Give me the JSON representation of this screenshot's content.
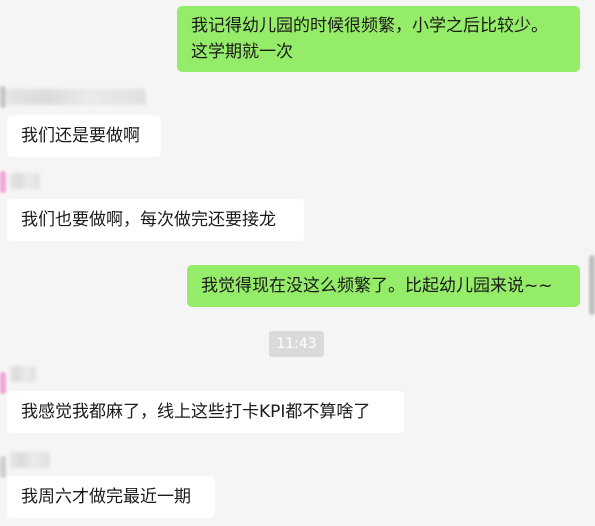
{
  "messages": [
    {
      "side": "self",
      "text": "我记得幼儿园的时候很频繁，小学之后比较少。\n这学期就一次"
    },
    {
      "side": "other",
      "text": "我们还是要做啊"
    },
    {
      "side": "other",
      "text": "我们也要做啊，每次做完还要接龙"
    },
    {
      "side": "self",
      "text": "我觉得现在没这么频繁了。比起幼儿园来说~~"
    },
    {
      "side": "other",
      "text": "我感觉我都麻了，线上这些打卡KPI都不算啥了"
    },
    {
      "side": "other",
      "text": "我周六才做完最近一期"
    }
  ],
  "timestamp": "11:43",
  "colors": {
    "self_bubble": "#95ec69",
    "other_bubble": "#ffffff",
    "background": "#f5f5f5",
    "timestamp_bg": "#dadada"
  }
}
